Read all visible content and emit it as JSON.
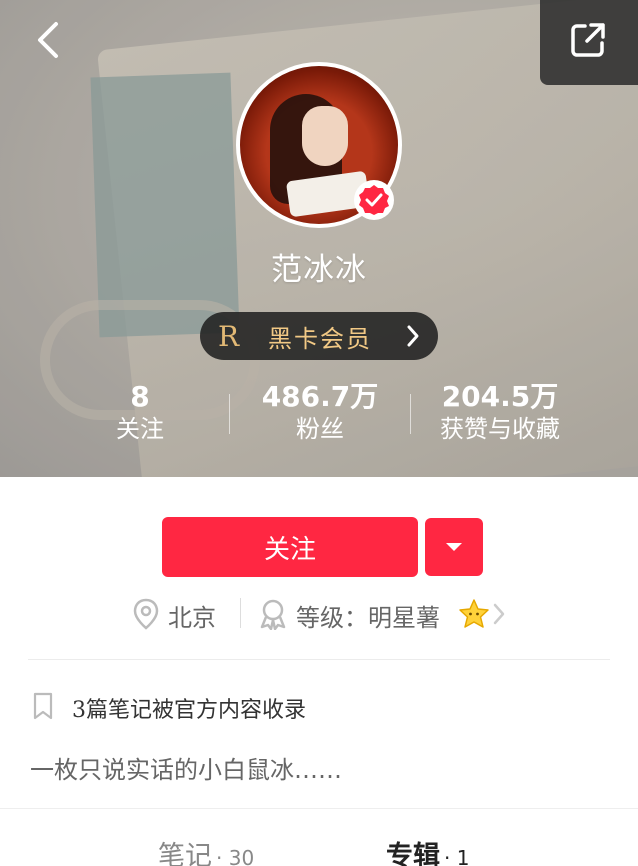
{
  "profile": {
    "name": "范冰冰",
    "vip": {
      "letter": "R",
      "label": "黑卡会员"
    }
  },
  "stats": [
    {
      "value": "8",
      "label": "关注"
    },
    {
      "value": "486.7万",
      "label": "粉丝"
    },
    {
      "value": "204.5万",
      "label": "获赞与收藏"
    }
  ],
  "actions": {
    "follow_label": "关注"
  },
  "meta": {
    "location": "北京",
    "level": "等级：明星薯"
  },
  "collected_text": "3篇笔记被官方内容收录",
  "bio": "一枚只说实话的小白鼠冰……",
  "tabs": [
    {
      "label": "笔记",
      "count": "· 30"
    },
    {
      "label": "专辑",
      "count": "· 1"
    }
  ],
  "colors": {
    "accent": "#ff2742",
    "vip_gold": "#f2c985"
  }
}
